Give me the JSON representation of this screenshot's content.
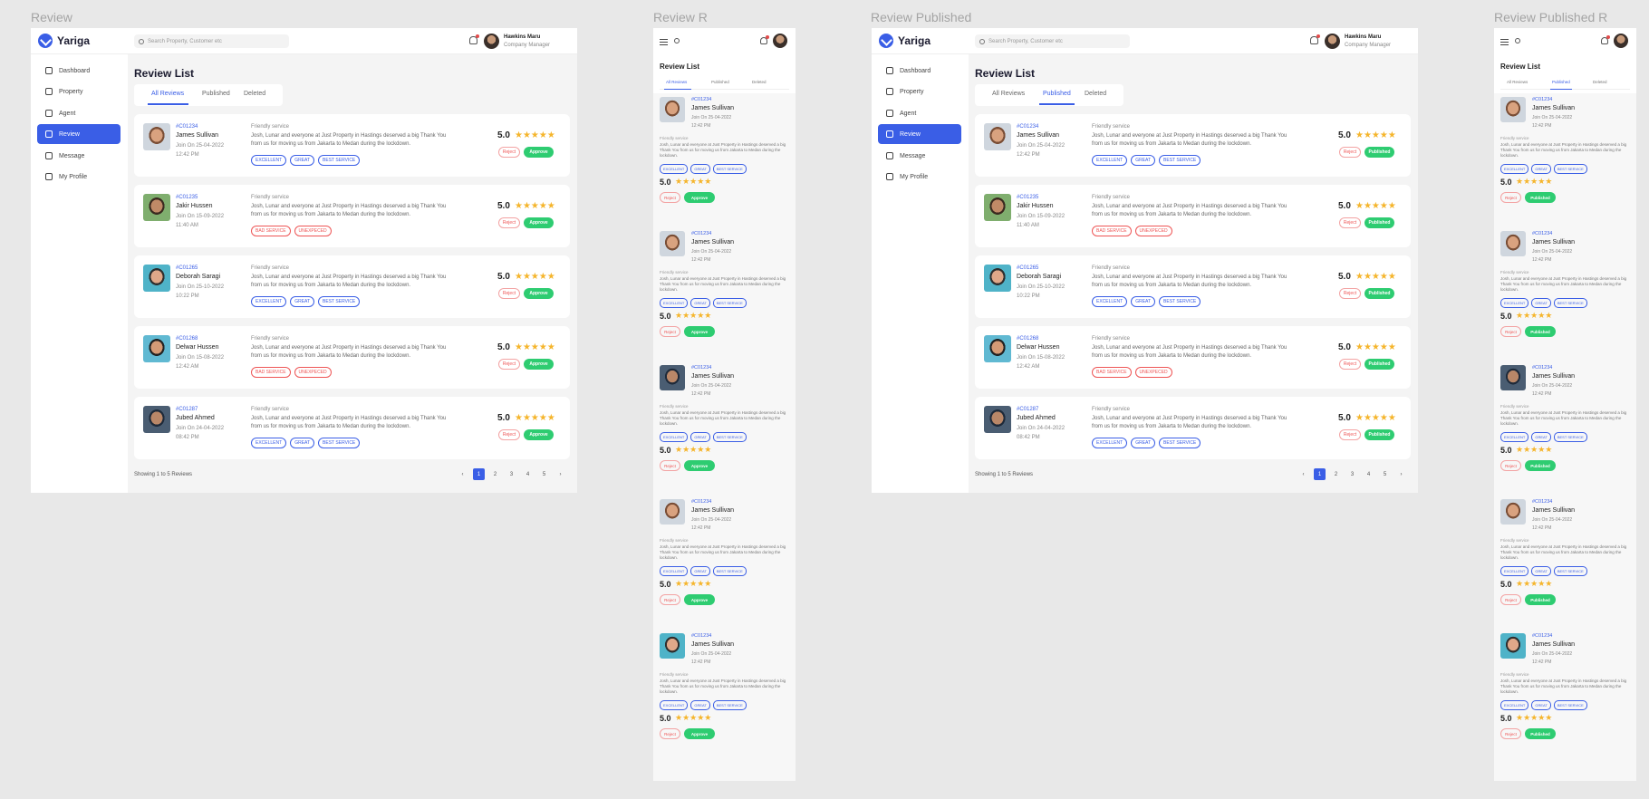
{
  "frames": {
    "review": "Review",
    "review_r": "Review R",
    "review_published": "Review Published",
    "review_published_r": "Review Published R"
  },
  "app": {
    "name": "Yariga"
  },
  "search": {
    "placeholder": "Search Property, Customer etc"
  },
  "user": {
    "name": "Hawkins Maru",
    "role": "Company Manager"
  },
  "sidebar": {
    "items": [
      {
        "label": "Dashboard",
        "icon": "dashboard-icon"
      },
      {
        "label": "Property",
        "icon": "building-icon"
      },
      {
        "label": "Agent",
        "icon": "user-icon"
      },
      {
        "label": "Review",
        "icon": "star-icon"
      },
      {
        "label": "Message",
        "icon": "message-icon"
      },
      {
        "label": "My Profile",
        "icon": "profile-icon"
      }
    ]
  },
  "page": {
    "title": "Review List"
  },
  "tabs": [
    "All Reviews",
    "Published",
    "Deleted"
  ],
  "reviews": [
    {
      "id": "#C01234",
      "name": "James Sullivan",
      "date": "Join On 25-04-2022",
      "time": "12:42 PM",
      "subject": "Friendly service",
      "text": "Josh, Lunar and everyone at Just Property in Hastings deserved a big Thank You from us for moving us from Jakarta to Medan during the lockdown.",
      "tags": [
        "EXCELLENT",
        "GREAT",
        "BEST SERVICE"
      ],
      "tag_tone": "blue",
      "score": "5.0"
    },
    {
      "id": "#C01235",
      "name": "Jakir Hussen",
      "date": "Join On 15-09-2022",
      "time": "11:40 AM",
      "subject": "Friendly service",
      "text": "Josh, Lunar and everyone at Just Property in Hastings deserved a big Thank You from us for moving us from Jakarta to Medan during the lockdown.",
      "tags": [
        "BAD SERVICE",
        "UNEXPECED"
      ],
      "tag_tone": "red",
      "score": "5.0"
    },
    {
      "id": "#C01265",
      "name": "Deborah Saragi",
      "date": "Join On 25-10-2022",
      "time": "10:22 PM",
      "subject": "Friendly service",
      "text": "Josh, Lunar and everyone at Just Property in Hastings deserved a big Thank You from us for moving us from Jakarta to Medan during the lockdown.",
      "tags": [
        "EXCELLENT",
        "GREAT",
        "BEST SERVICE"
      ],
      "tag_tone": "blue",
      "score": "5.0"
    },
    {
      "id": "#C01268",
      "name": "Delwar Hussen",
      "date": "Join On 15-08-2022",
      "time": "12:42 AM",
      "subject": "Friendly service",
      "text": "Josh, Lunar and everyone at Just Property in Hastings deserved a big Thank You from us for moving us from Jakarta to Medan during the lockdown.",
      "tags": [
        "BAD SERVICE",
        "UNEXPECED"
      ],
      "tag_tone": "red",
      "score": "5.0"
    },
    {
      "id": "#C01287",
      "name": "Jubed Ahmed",
      "date": "Join On 24-04-2022",
      "time": "08:42 PM",
      "subject": "Friendly service",
      "text": "Josh, Lunar and everyone at Just Property in Hastings deserved a big Thank You from us for moving us from Jakarta to Medan during the lockdown.",
      "tags": [
        "EXCELLENT",
        "GREAT",
        "BEST SERVICE"
      ],
      "tag_tone": "blue",
      "score": "5.0"
    }
  ],
  "buttons": {
    "reject": "Reject",
    "approve": "Approve",
    "published": "Published"
  },
  "footer": {
    "showing": "Showing 1 to 5 Reviews",
    "pages": [
      "1",
      "2",
      "3",
      "4",
      "5"
    ],
    "current_page": "1"
  },
  "stars": "★★★★★",
  "colors": {
    "accent": "#3a5ee6",
    "success": "#2ecc71",
    "star": "#f5b52c",
    "danger": "#e55555"
  }
}
